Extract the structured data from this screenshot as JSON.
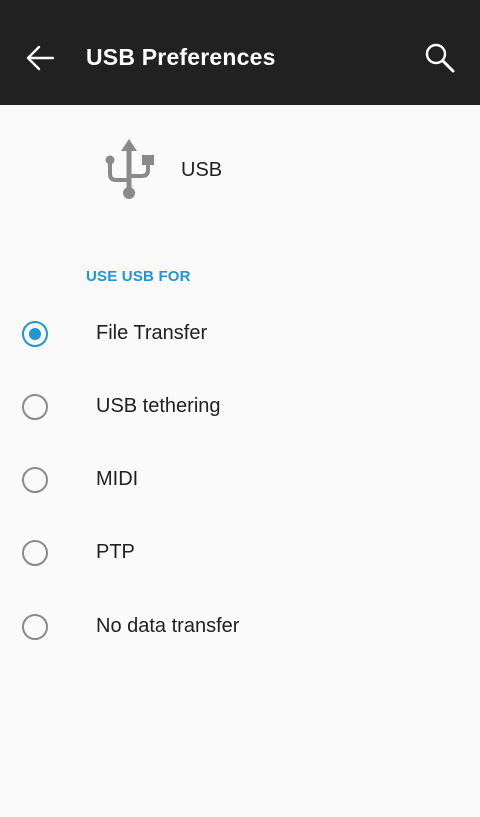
{
  "app_bar": {
    "title": "USB Preferences",
    "back_icon": "arrow-back-icon",
    "search_icon": "search-icon"
  },
  "header": {
    "icon": "usb-icon",
    "label": "USB"
  },
  "section": {
    "title": "USE USB FOR"
  },
  "options": [
    {
      "label": "File Transfer",
      "selected": true
    },
    {
      "label": "USB tethering",
      "selected": false
    },
    {
      "label": "MIDI",
      "selected": false
    },
    {
      "label": "PTP",
      "selected": false
    },
    {
      "label": "No data transfer",
      "selected": false
    }
  ],
  "colors": {
    "app_bar": "#212121",
    "accent": "#2196d3",
    "background": "#fafafa",
    "icon_gray": "#8a8a8a"
  }
}
